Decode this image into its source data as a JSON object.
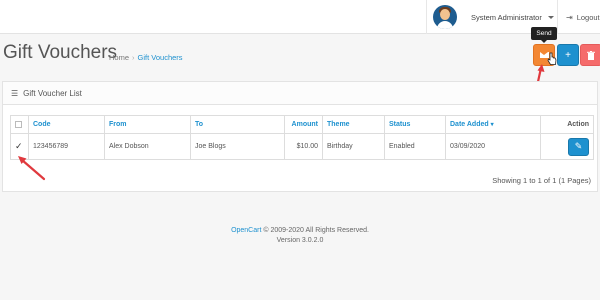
{
  "header": {
    "user_name": "System Administrator",
    "logout_label": "Logout"
  },
  "page": {
    "title": "Gift Vouchers",
    "breadcrumb": [
      "Home",
      "Gift Vouchers"
    ]
  },
  "toolbar": {
    "send_tooltip": "Send",
    "send_icon": "envelope-icon",
    "add_icon": "plus-icon",
    "delete_icon": "trash-icon"
  },
  "panel": {
    "heading": "Gift Voucher List",
    "columns": [
      "Code",
      "From",
      "To",
      "Amount",
      "Theme",
      "Status",
      "Date Added",
      "Action"
    ],
    "rows": [
      {
        "checked": true,
        "code": "123456789",
        "from": "Alex Dobson",
        "to": "Joe Blogs",
        "amount": "$10.00",
        "theme": "Birthday",
        "status": "Enabled",
        "date_added": "03/09/2020"
      }
    ],
    "showing": "Showing 1 to 1 of 1 (1 Pages)"
  },
  "footer": {
    "brand": "OpenCart",
    "copyright": "© 2009-2020 All Rights Reserved.",
    "version": "Version 3.0.2.0"
  },
  "colors": {
    "send_button": "#f38733",
    "add_button": "#1e91cf",
    "delete_button": "#f56b6b",
    "annotation_arrow": "#e0393e",
    "link": "#1e91cf"
  }
}
